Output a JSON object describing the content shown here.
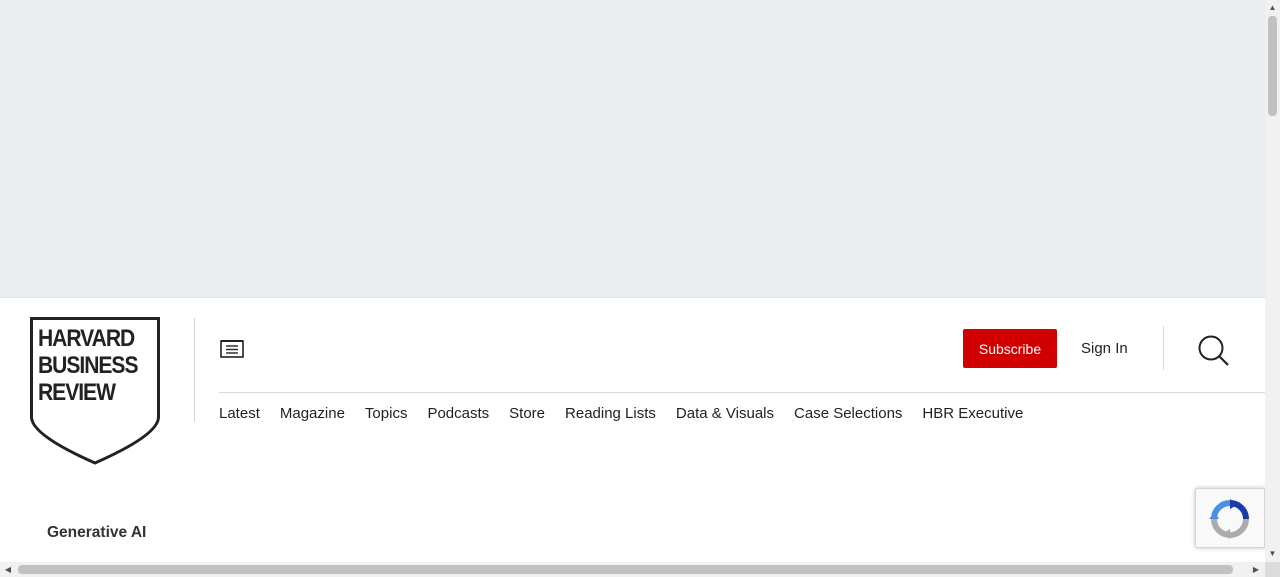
{
  "logo": {
    "lines": [
      "HARVARD",
      "BUSINESS",
      "REVIEW"
    ]
  },
  "header": {
    "subscribe_label": "Subscribe",
    "signin_label": "Sign In"
  },
  "nav": {
    "items": [
      {
        "label": "Latest"
      },
      {
        "label": "Magazine"
      },
      {
        "label": "Topics"
      },
      {
        "label": "Podcasts"
      },
      {
        "label": "Store"
      },
      {
        "label": "Reading Lists"
      },
      {
        "label": "Data & Visuals"
      },
      {
        "label": "Case Selections"
      },
      {
        "label": "HBR Executive"
      }
    ]
  },
  "main": {
    "topic_label": "Generative AI"
  },
  "icons": {
    "menu": "menu-icon",
    "search": "search-icon",
    "recaptcha": "recaptcha-icon"
  },
  "colors": {
    "brand_red": "#d10000",
    "ad_background": "#e9edf0"
  }
}
